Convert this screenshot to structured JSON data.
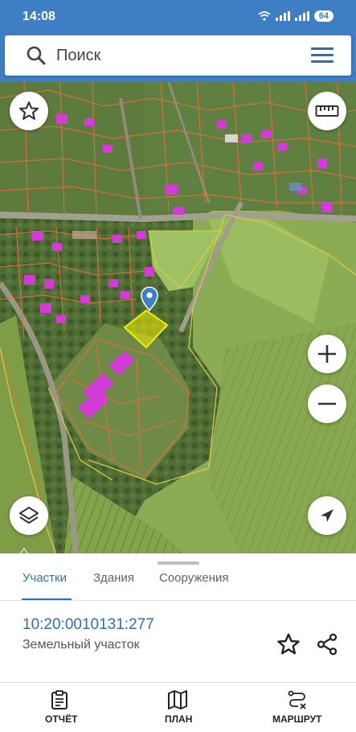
{
  "status_bar": {
    "time": "14:08",
    "battery": "64"
  },
  "search": {
    "placeholder": "Поиск"
  },
  "map": {
    "controls": [
      "favorites-icon",
      "ruler-icon",
      "zoom-in-icon",
      "zoom-out-icon",
      "layers-icon",
      "location-arrow-icon"
    ]
  },
  "sheet": {
    "tabs": [
      "Участки",
      "Здания",
      "Сооружения"
    ],
    "active_tab": "Участки",
    "cadastral_number": "10:20:0010131:277",
    "parcel_type": "Земельный участок"
  },
  "bottom_nav": {
    "report": "ОТЧЁТ",
    "plan": "ПЛАН",
    "route": "МАРШРУТ"
  },
  "colors": {
    "primary": "#3d7ec4",
    "accent": "#2c6fb7",
    "parcel_outline": "#e0703a",
    "parcel_highlight": "#f5f000",
    "building": "#d43bd6"
  }
}
